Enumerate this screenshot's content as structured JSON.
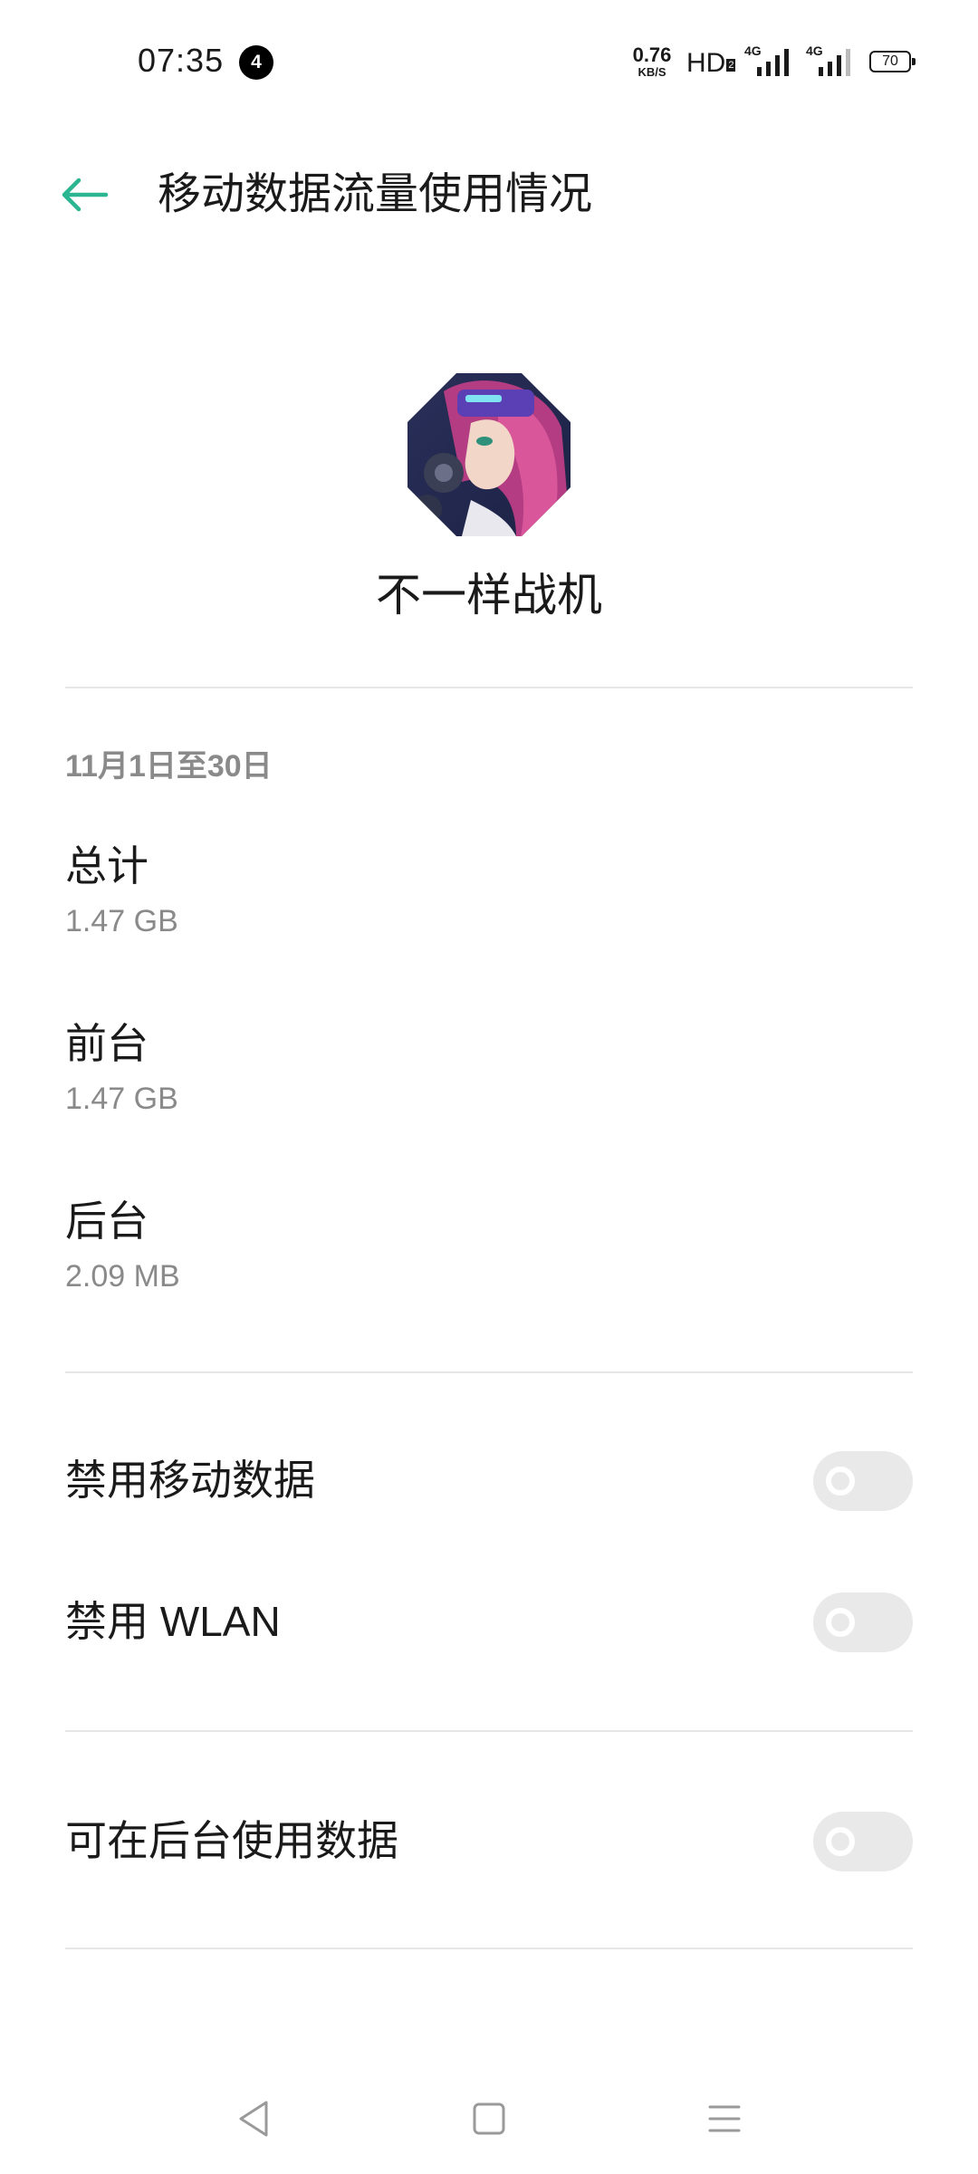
{
  "status_bar": {
    "time": "07:35",
    "notification_count": "4",
    "net_speed_value": "0.76",
    "net_speed_unit": "KB/S",
    "hd_label": "HD",
    "hd_sub": "2",
    "sim1_label": "4G",
    "sim2_label": "4G",
    "battery_level": "70"
  },
  "header": {
    "title": "移动数据流量使用情况",
    "back_icon": "arrow-left-icon",
    "accent_color": "#2bb590"
  },
  "app": {
    "name": "不一样战机",
    "icon": "app-avatar-icon"
  },
  "usage": {
    "period": "11月1日至30日",
    "items": [
      {
        "title": "总计",
        "value": "1.47 GB"
      },
      {
        "title": "前台",
        "value": "1.47 GB"
      },
      {
        "title": "后台",
        "value": "2.09 MB"
      }
    ]
  },
  "toggles": [
    {
      "label": "禁用移动数据",
      "enabled": false
    },
    {
      "label": "禁用 WLAN",
      "enabled": false
    },
    {
      "label": "可在后台使用数据",
      "enabled": false
    }
  ],
  "nav_bar": {
    "back_icon": "triangle-back-icon",
    "home_icon": "square-home-icon",
    "menu_icon": "hamburger-menu-icon"
  }
}
